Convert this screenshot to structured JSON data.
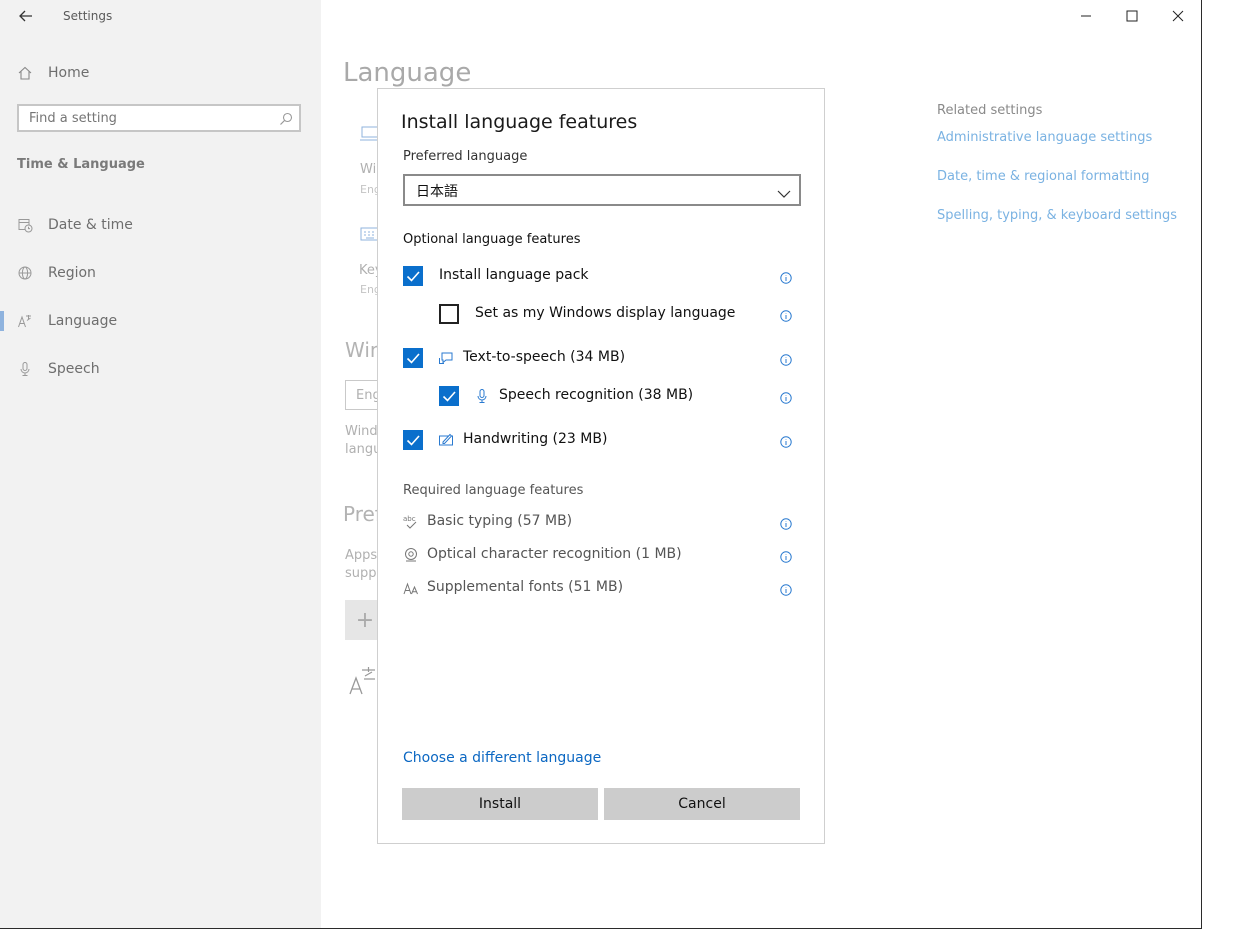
{
  "window": {
    "title": "Settings"
  },
  "sidebar": {
    "home": "Home",
    "search_placeholder": "Find a setting",
    "section": "Time & Language",
    "items": [
      {
        "label": "Date & time",
        "icon": "calendar-clock-icon"
      },
      {
        "label": "Region",
        "icon": "globe-icon"
      },
      {
        "label": "Language",
        "icon": "language-icon",
        "selected": true
      },
      {
        "label": "Speech",
        "icon": "microphone-icon"
      }
    ]
  },
  "main": {
    "title": "Language",
    "bg_fragments": {
      "win1": "Wi",
      "eng1": "Eng",
      "key": "Key",
      "eng2": "Eng",
      "win_heading": "Win",
      "input_fragment": "Eng",
      "wind": "Wind",
      "langu": "langu",
      "pref": "Pref",
      "apps": "Apps",
      "suppo": "suppo",
      "plus": "+"
    }
  },
  "related": {
    "heading": "Related settings",
    "links": [
      "Administrative language settings",
      "Date, time & regional formatting",
      "Spelling, typing, & keyboard settings"
    ]
  },
  "dialog": {
    "title": "Install language features",
    "preferred_label": "Preferred language",
    "preferred_value": "日本語",
    "optional_heading": "Optional language features",
    "optional": [
      {
        "label": "Install language pack",
        "checked": true
      },
      {
        "label": "Set as my Windows display language",
        "checked": false
      },
      {
        "label": "Text-to-speech (34 MB)",
        "checked": true,
        "icon": "text-to-speech-icon"
      },
      {
        "label": "Speech recognition (38 MB)",
        "checked": true,
        "icon": "microphone-icon"
      },
      {
        "label": "Handwriting (23 MB)",
        "checked": true,
        "icon": "handwriting-icon"
      }
    ],
    "required_heading": "Required language features",
    "required": [
      {
        "label": "Basic typing (57 MB)",
        "icon": "spellcheck-icon"
      },
      {
        "label": "Optical character recognition (1 MB)",
        "icon": "ocr-icon"
      },
      {
        "label": "Supplemental fonts (51 MB)",
        "icon": "font-icon"
      }
    ],
    "choose_link": "Choose a different language",
    "install_label": "Install",
    "cancel_label": "Cancel"
  },
  "colors": {
    "accent": "#0a6fcc",
    "link": "#0b67c2",
    "related_link": "#7ab2e2"
  }
}
